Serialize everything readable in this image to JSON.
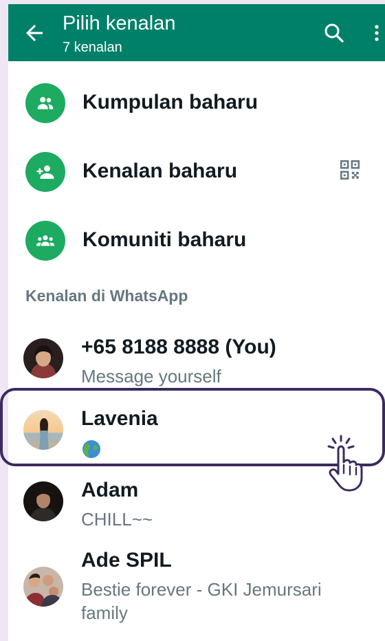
{
  "header": {
    "title": "Pilih kenalan",
    "subtitle": "7 kenalan",
    "icons": [
      "arrow-left-icon",
      "search-icon",
      "more-vert-icon"
    ],
    "color": "#008069"
  },
  "actions": [
    {
      "label": "Kumpulan baharu",
      "icon": "group-icon"
    },
    {
      "label": "Kenalan baharu",
      "icon": "person-add-icon",
      "trailing_icon": "qr-code-icon"
    },
    {
      "label": "Komuniti baharu",
      "icon": "community-icon"
    }
  ],
  "section_label": "Kenalan di WhatsApp",
  "contacts": [
    {
      "name": "+65 8188 8888 (You)",
      "status": "Message yourself"
    },
    {
      "name": "Lavenia",
      "status": "🌏",
      "highlighted": true
    },
    {
      "name": "Adam",
      "status": "CHILL~~"
    },
    {
      "name": "Ade SPIL",
      "status": "Bestie forever - GKI Jemursari family"
    }
  ],
  "accent_color": "#1daa61",
  "highlight_color": "#3b2a5e"
}
